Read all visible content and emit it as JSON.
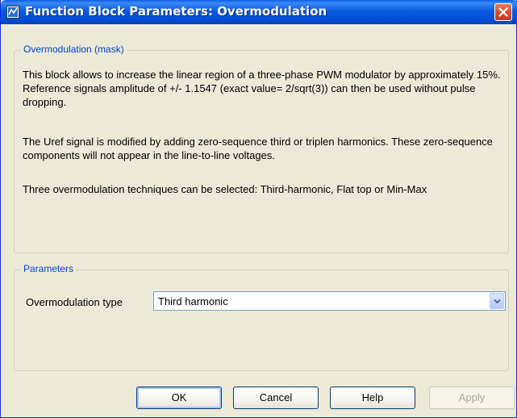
{
  "window": {
    "title": "Function Block Parameters: Overmodulation"
  },
  "mask_group": {
    "legend": "Overmodulation (mask)",
    "paragraphs": [
      "This block allows to increase the linear region of a three-phase PWM modulator by approximately 15%. Reference signals amplitude of +/- 1.1547 (exact value= 2/sqrt(3)) can then be used without pulse dropping.",
      "The Uref signal is modified by adding zero-sequence third or triplen harmonics. These zero-sequence components will not appear in the line-to-line voltages.",
      "Three overmodulation techniques can be selected: Third-harmonic, Flat top or Min-Max"
    ]
  },
  "parameters_group": {
    "legend": "Parameters",
    "overmodulation_type": {
      "label": "Overmodulation type",
      "value": "Third harmonic"
    }
  },
  "buttons": {
    "ok": "OK",
    "cancel": "Cancel",
    "help": "Help",
    "apply": "Apply"
  },
  "colors": {
    "titlebar": "#0A5AE0",
    "window_bg": "#ECE9D8",
    "legend_text": "#0046D5",
    "close_button": "#D9502F"
  },
  "icons": {
    "window_icon": "simulink-block-icon",
    "close": "close-icon",
    "dropdown": "chevron-down-icon"
  }
}
